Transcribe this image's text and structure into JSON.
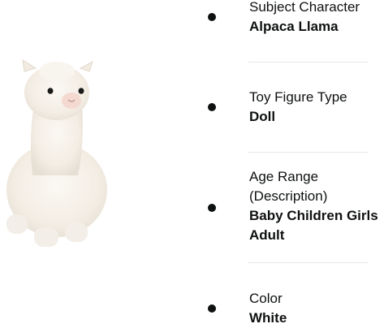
{
  "product": {
    "image_subject": "white alpaca llama plush toy"
  },
  "attributes": [
    {
      "label": "Subject Character",
      "value": "Alpaca Llama"
    },
    {
      "label": "Toy Figure Type",
      "value": "Doll"
    },
    {
      "label": "Age Range (Description)",
      "value": "Baby Children Girls Adult"
    },
    {
      "label": "Color",
      "value": "White"
    }
  ],
  "colors": {
    "text": "#0f1111",
    "divider": "#e3e6e6",
    "plush": "#f6f1ea"
  }
}
